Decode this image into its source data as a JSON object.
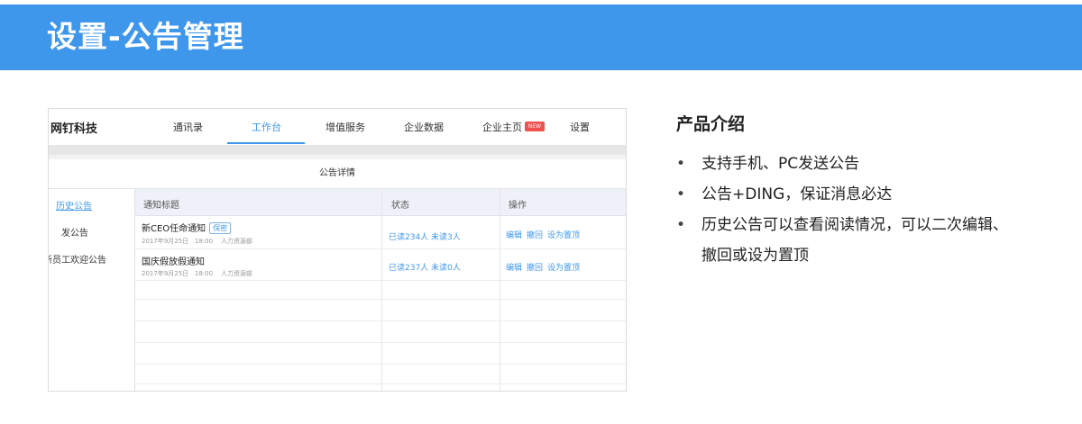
{
  "banner": {
    "title": "设置-公告管理"
  },
  "screenshot": {
    "brand": "网钉科技",
    "nav": [
      {
        "label": "通讯录"
      },
      {
        "label": "工作台"
      },
      {
        "label": "增值服务"
      },
      {
        "label": "企业数据"
      },
      {
        "label": "企业主页"
      },
      {
        "label": "设置"
      }
    ],
    "new_badge": "NEW",
    "detail_title": "公告详情",
    "sidebar": [
      {
        "label": "历史公告"
      },
      {
        "label": "发公告"
      },
      {
        "label": "新员工欢迎公告"
      }
    ],
    "table": {
      "headers": [
        "通知标题",
        "状态",
        "操作"
      ],
      "rows": [
        {
          "title": "新CEO任命通知",
          "tag": "保密",
          "date": "2017年9月25日",
          "time": "18:00",
          "dept": "人力资源部",
          "status": "已读234人 未读3人",
          "ops": [
            "编辑",
            "撤回",
            "设为置顶"
          ]
        },
        {
          "title": "国庆假放假通知",
          "tag": "",
          "date": "2017年9月25日",
          "time": "18:00",
          "dept": "人力资源部",
          "status": "已读237人 未读0人",
          "ops": [
            "编辑",
            "撤回",
            "设为置顶"
          ]
        }
      ]
    }
  },
  "intro": {
    "title": "产品介绍",
    "bullet_symbol": "•",
    "items": [
      "支持手机、PC发送公告",
      "公告+DING，保证消息必达",
      "历史公告可以查看阅读情况，可以二次编辑、",
      "撤回或设为置顶"
    ]
  },
  "colors": {
    "accent": "#3f97ec",
    "badge": "#f05050"
  }
}
